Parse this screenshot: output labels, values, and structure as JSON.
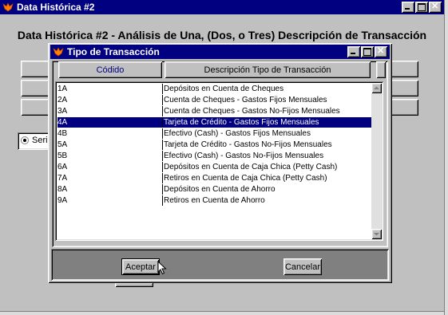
{
  "main_window": {
    "title": "Data Histórica #2",
    "heading": "Data Histórica #2 - Análisis de Una, (Dos, o Tres) Descripción de Transacción",
    "radio_label": "Serie"
  },
  "dialog": {
    "title": "Tipo de Transacción",
    "columns": [
      "Códido",
      "Descripción Tipo de Transacción"
    ],
    "rows": [
      {
        "code": "1A",
        "desc": "Depósitos en Cuenta de Cheques"
      },
      {
        "code": "2A",
        "desc": "Cuenta de Cheques - Gastos Fijos Mensuales"
      },
      {
        "code": "3A",
        "desc": "Cuenta de Cheques - Gastos No-Fijos Mensuales"
      },
      {
        "code": "4A",
        "desc": "Tarjeta de Crédito - Gastos Fijos Mensuales"
      },
      {
        "code": "4B",
        "desc": "Efectivo (Cash) - Gastos Fijos Mensuales"
      },
      {
        "code": "5A",
        "desc": "Tarjeta de Crédito - Gastos No-Fijos Mensuales"
      },
      {
        "code": "5B",
        "desc": "Efectivo (Cash) - Gastos No-Fijos Mensuales"
      },
      {
        "code": "6A",
        "desc": "Depósitos en Cuenta de Caja Chica (Petty Cash)"
      },
      {
        "code": "7A",
        "desc": "Retiros en Cuenta de Caja Chica (Petty Cash)"
      },
      {
        "code": "8A",
        "desc": "Depósitos en Cuenta de Ahorro"
      },
      {
        "code": "9A",
        "desc": "Retiros en Cuenta de Ahorro"
      }
    ],
    "selected_code": "4A",
    "accept_label": "Aceptar",
    "cancel_label": "Cancelar"
  },
  "colors": {
    "titlebar": "#000080",
    "selection": "#000080",
    "face": "#c0c0c0"
  }
}
